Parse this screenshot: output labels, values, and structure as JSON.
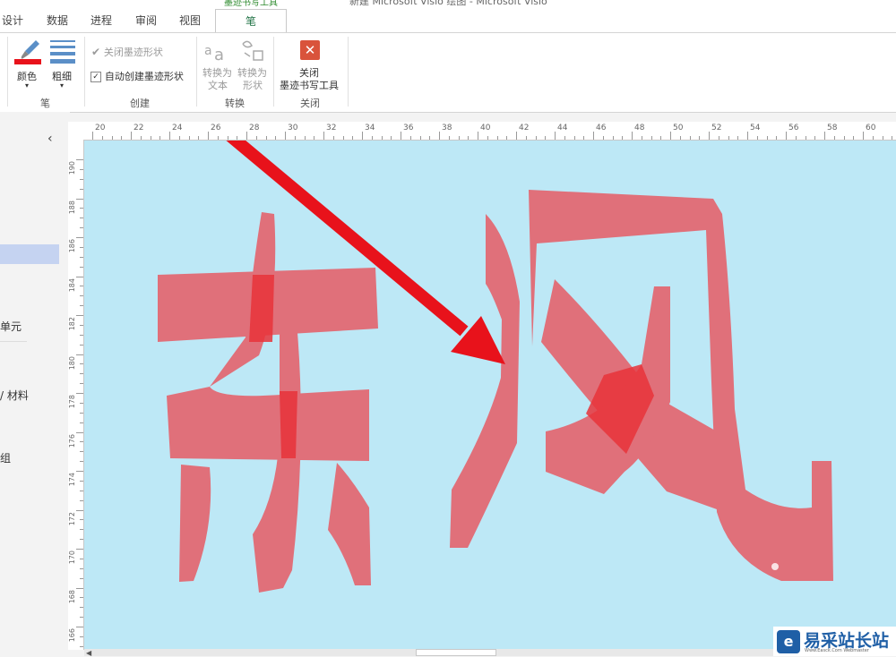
{
  "window": {
    "title": "新建 Microsoft Visio 绘图 - Microsoft Visio"
  },
  "tabs": {
    "design": "设计",
    "data": "数据",
    "process": "进程",
    "review": "审阅",
    "view": "视图",
    "context_group": "墨迹书写工具",
    "pen": "笔"
  },
  "ribbon": {
    "pen_group": {
      "color_label": "颜色",
      "weight_label": "粗细",
      "group_label": "笔"
    },
    "create_group": {
      "close_ink_shape": "关闭墨迹形状",
      "auto_create_ink_shape": "自动创建墨迹形状",
      "group_label": "创建"
    },
    "convert_group": {
      "to_text_line1": "转换为",
      "to_text_line2": "文本",
      "to_shape_line1": "转换为",
      "to_shape_line2": "形状",
      "group_label": "转换"
    },
    "close_group": {
      "close_line1": "关闭",
      "close_line2": "墨迹书写工具",
      "group_label": "关闭"
    }
  },
  "left_pane": {
    "collapse_glyph": "‹",
    "item1": "单元",
    "item2": "/ 材料",
    "item3": "组"
  },
  "ruler_h": [
    "20",
    "22",
    "24",
    "26",
    "28",
    "30",
    "32",
    "34",
    "36",
    "38",
    "40",
    "42",
    "44",
    "46",
    "48",
    "50",
    "52",
    "54",
    "56",
    "58",
    "60"
  ],
  "ruler_v": [
    "190",
    "188",
    "186",
    "184",
    "182",
    "180",
    "178",
    "176",
    "174",
    "172",
    "170",
    "168",
    "166"
  ],
  "watermark": {
    "text": "易采站长站",
    "subtext": "Www.Easck.Com Webmaster"
  },
  "colors": {
    "canvas": "#bde8f6",
    "ink": "#e0707a",
    "arrow": "#e8121b",
    "accent_green": "#217346",
    "close_red": "#d9533b"
  }
}
